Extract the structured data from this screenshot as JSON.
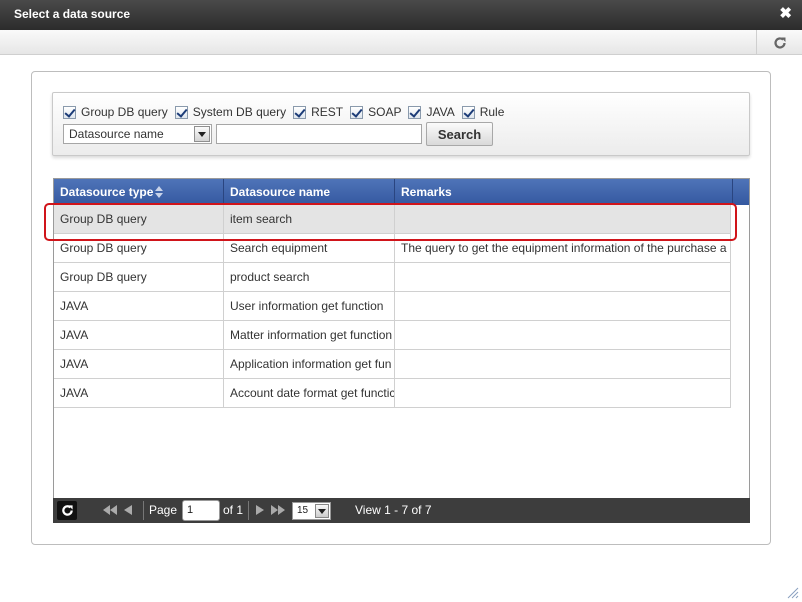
{
  "window": {
    "title": "Select a data source"
  },
  "filters": {
    "checkboxes": [
      {
        "label": "Group DB query",
        "checked": true
      },
      {
        "label": "System DB query",
        "checked": true
      },
      {
        "label": "REST",
        "checked": true
      },
      {
        "label": "SOAP",
        "checked": true
      },
      {
        "label": "JAVA",
        "checked": true
      },
      {
        "label": "Rule",
        "checked": true
      }
    ],
    "field_select": "Datasource name",
    "search_value": "",
    "search_label": "Search"
  },
  "grid": {
    "columns": [
      "Datasource type",
      "Datasource name",
      "Remarks"
    ],
    "rows": [
      {
        "type": "Group DB query",
        "name": "item search",
        "remarks": ""
      },
      {
        "type": "Group DB query",
        "name": "Search equipment",
        "remarks": "The query to get the equipment information of the purchase a"
      },
      {
        "type": "Group DB query",
        "name": "product search",
        "remarks": ""
      },
      {
        "type": "JAVA",
        "name": "User information get function",
        "remarks": ""
      },
      {
        "type": "JAVA",
        "name": "Matter information get function",
        "remarks": ""
      },
      {
        "type": "JAVA",
        "name": "Application information get fun",
        "remarks": ""
      },
      {
        "type": "JAVA",
        "name": "Account date format get functic",
        "remarks": ""
      }
    ],
    "selected_row": 0
  },
  "pager": {
    "page_label": "Page",
    "page_value": "1",
    "of_label": "of 1",
    "rows_per_page": "15",
    "view_text": "View 1 - 7 of 7"
  },
  "colors": {
    "header": "#3f62a8",
    "highlight": "#d0141a",
    "pager": "#3d3d3d"
  }
}
